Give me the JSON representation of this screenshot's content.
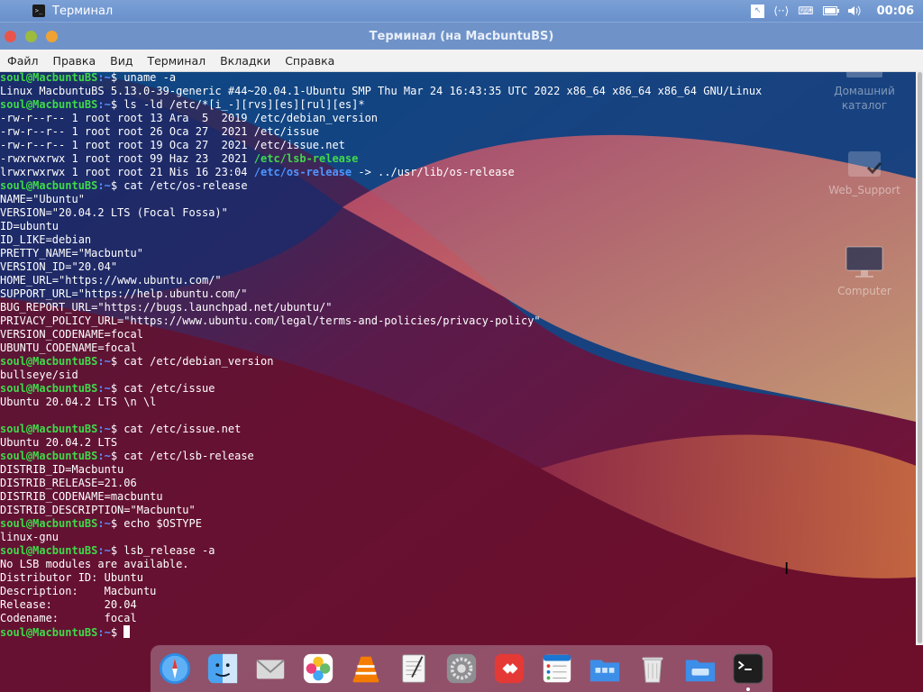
{
  "top_panel": {
    "app_name": "Терминал",
    "app_icon_glyph": ">_",
    "clock": "00:06",
    "tray_icons": [
      "cursor-icon",
      "network-icon",
      "keyboard-icon",
      "battery-icon",
      "volume-icon"
    ]
  },
  "window": {
    "title": "Терминал (на MacbuntuBS)"
  },
  "menubar": {
    "items": [
      "Файл",
      "Правка",
      "Вид",
      "Терминал",
      "Вкладки",
      "Справка"
    ]
  },
  "desktop_icons": [
    {
      "label": "Домашний каталог"
    },
    {
      "label": "Web_Support"
    },
    {
      "label": "Computer"
    }
  ],
  "terminal": {
    "prompt_user": "soul@MacbuntuBS",
    "prompt_path": ":~",
    "prompt_symbol": "$ ",
    "lines": [
      {
        "type": "cmd",
        "text": "uname -a"
      },
      {
        "type": "out",
        "text": "Linux MacbuntuBS 5.13.0-39-generic #44~20.04.1-Ubuntu SMP Thu Mar 24 16:43:35 UTC 2022 x86_64 x86_64 x86_64 GNU/Linux"
      },
      {
        "type": "cmd",
        "text": "ls -ld /etc/*[i_-][rvs][es][rul][es]*"
      },
      {
        "type": "out",
        "text": "-rw-r--r-- 1 root root 13 Ara  5  2019 /etc/debian_version"
      },
      {
        "type": "out",
        "text": "-rw-r--r-- 1 root root 26 Oca 27  2021 /etc/issue"
      },
      {
        "type": "out",
        "text": "-rw-r--r-- 1 root root 19 Oca 27  2021 /etc/issue.net"
      },
      {
        "type": "out-green",
        "prefix": "-rwxrwxrwx 1 root root 99 Haz 23  2021 ",
        "highlight": "/etc/lsb-release",
        "suffix": ""
      },
      {
        "type": "out-blue",
        "prefix": "lrwxrwxrwx 1 root root 21 Nis 16 23:04 ",
        "highlight": "/etc/os-release",
        "suffix": " -> ../usr/lib/os-release"
      },
      {
        "type": "cmd",
        "text": "cat /etc/os-release"
      },
      {
        "type": "out",
        "text": "NAME=\"Ubuntu\""
      },
      {
        "type": "out",
        "text": "VERSION=\"20.04.2 LTS (Focal Fossa)\""
      },
      {
        "type": "out",
        "text": "ID=ubuntu"
      },
      {
        "type": "out",
        "text": "ID_LIKE=debian"
      },
      {
        "type": "out",
        "text": "PRETTY_NAME=\"Macbuntu\""
      },
      {
        "type": "out",
        "text": "VERSION_ID=\"20.04\""
      },
      {
        "type": "out",
        "text": "HOME_URL=\"https://www.ubuntu.com/\""
      },
      {
        "type": "out",
        "text": "SUPPORT_URL=\"https://help.ubuntu.com/\""
      },
      {
        "type": "out",
        "text": "BUG_REPORT_URL=\"https://bugs.launchpad.net/ubuntu/\""
      },
      {
        "type": "out",
        "text": "PRIVACY_POLICY_URL=\"https://www.ubuntu.com/legal/terms-and-policies/privacy-policy\""
      },
      {
        "type": "out",
        "text": "VERSION_CODENAME=focal"
      },
      {
        "type": "out",
        "text": "UBUNTU_CODENAME=focal"
      },
      {
        "type": "cmd",
        "text": "cat /etc/debian_version"
      },
      {
        "type": "out",
        "text": "bullseye/sid"
      },
      {
        "type": "cmd",
        "text": "cat /etc/issue"
      },
      {
        "type": "out",
        "text": "Ubuntu 20.04.2 LTS \\n \\l"
      },
      {
        "type": "out",
        "text": ""
      },
      {
        "type": "cmd",
        "text": "cat /etc/issue.net"
      },
      {
        "type": "out",
        "text": "Ubuntu 20.04.2 LTS"
      },
      {
        "type": "cmd",
        "text": "cat /etc/lsb-release"
      },
      {
        "type": "out",
        "text": "DISTRIB_ID=Macbuntu"
      },
      {
        "type": "out",
        "text": "DISTRIB_RELEASE=21.06"
      },
      {
        "type": "out",
        "text": "DISTRIB_CODENAME=macbuntu"
      },
      {
        "type": "out",
        "text": "DISTRIB_DESCRIPTION=\"Macbuntu\""
      },
      {
        "type": "cmd",
        "text": "echo $OSTYPE"
      },
      {
        "type": "out",
        "text": "linux-gnu"
      },
      {
        "type": "cmd",
        "text": "lsb_release -a"
      },
      {
        "type": "out",
        "text": "No LSB modules are available."
      },
      {
        "type": "out",
        "text": "Distributor ID:\tUbuntu"
      },
      {
        "type": "out",
        "text": "Description:\tMacbuntu"
      },
      {
        "type": "out",
        "text": "Release:\t20.04"
      },
      {
        "type": "out",
        "text": "Codename:\tfocal"
      },
      {
        "type": "prompt",
        "text": ""
      }
    ]
  },
  "dock": {
    "items": [
      {
        "name": "safari-icon"
      },
      {
        "name": "finder-icon"
      },
      {
        "name": "mail-icon"
      },
      {
        "name": "photos-icon"
      },
      {
        "name": "vlc-icon"
      },
      {
        "name": "text-editor-icon"
      },
      {
        "name": "settings-icon"
      },
      {
        "name": "anydesk-icon"
      },
      {
        "name": "tasks-icon"
      },
      {
        "name": "app-folder-icon"
      },
      {
        "name": "trash-icon"
      },
      {
        "name": "folder-icon"
      },
      {
        "name": "terminal-icon",
        "running": true
      }
    ]
  },
  "colors": {
    "prompt_user": "#3fd94a",
    "prompt_path": "#5a8fff",
    "titlebar": "#6f93c9",
    "panel": "#7aa0d6"
  }
}
